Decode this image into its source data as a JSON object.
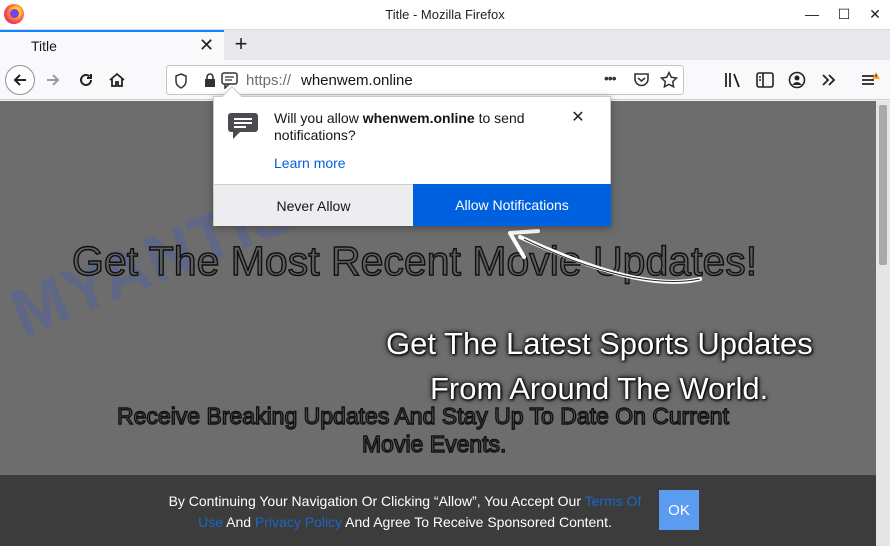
{
  "window": {
    "title": "Title - Mozilla Firefox",
    "minimize": "—",
    "maximize": "☐",
    "close": "✕"
  },
  "tab": {
    "title": "Title",
    "close": "✕",
    "new_tab": "+"
  },
  "urlbar": {
    "protocol": "https://",
    "host": "whenwem.online",
    "more": "•••"
  },
  "popup": {
    "message_prefix": "Will you allow ",
    "site": "whenwem.online",
    "message_suffix": " to send notifications?",
    "learn_more": "Learn more",
    "close": "✕",
    "never_allow": "Never Allow",
    "allow": "Allow Notifications"
  },
  "page": {
    "headline": "Get The Most Recent Movie Updates!",
    "sports_line1": "Get The Latest Sports Updates",
    "sports_line2": "From Around The World.",
    "sub_line1": "Receive Breaking Updates And Stay Up To Date On Current",
    "sub_line2": "Movie Events.",
    "watermark": "MYANTISPYWARE.COM"
  },
  "cookie": {
    "text_part1": "By Continuing Your Navigation Or Clicking “Allow”, You Accept Our ",
    "terms_link": "Terms Of Use",
    "text_part2": " And ",
    "privacy_link": "Privacy Policy",
    "text_part3": " And Agree To Receive Sponsored Content.",
    "ok_label": "OK"
  },
  "colors": {
    "accent": "#0061e0",
    "tab_highlight": "#0a84ff",
    "ok_button": "#5b9bf0",
    "link": "#1a66c8"
  }
}
